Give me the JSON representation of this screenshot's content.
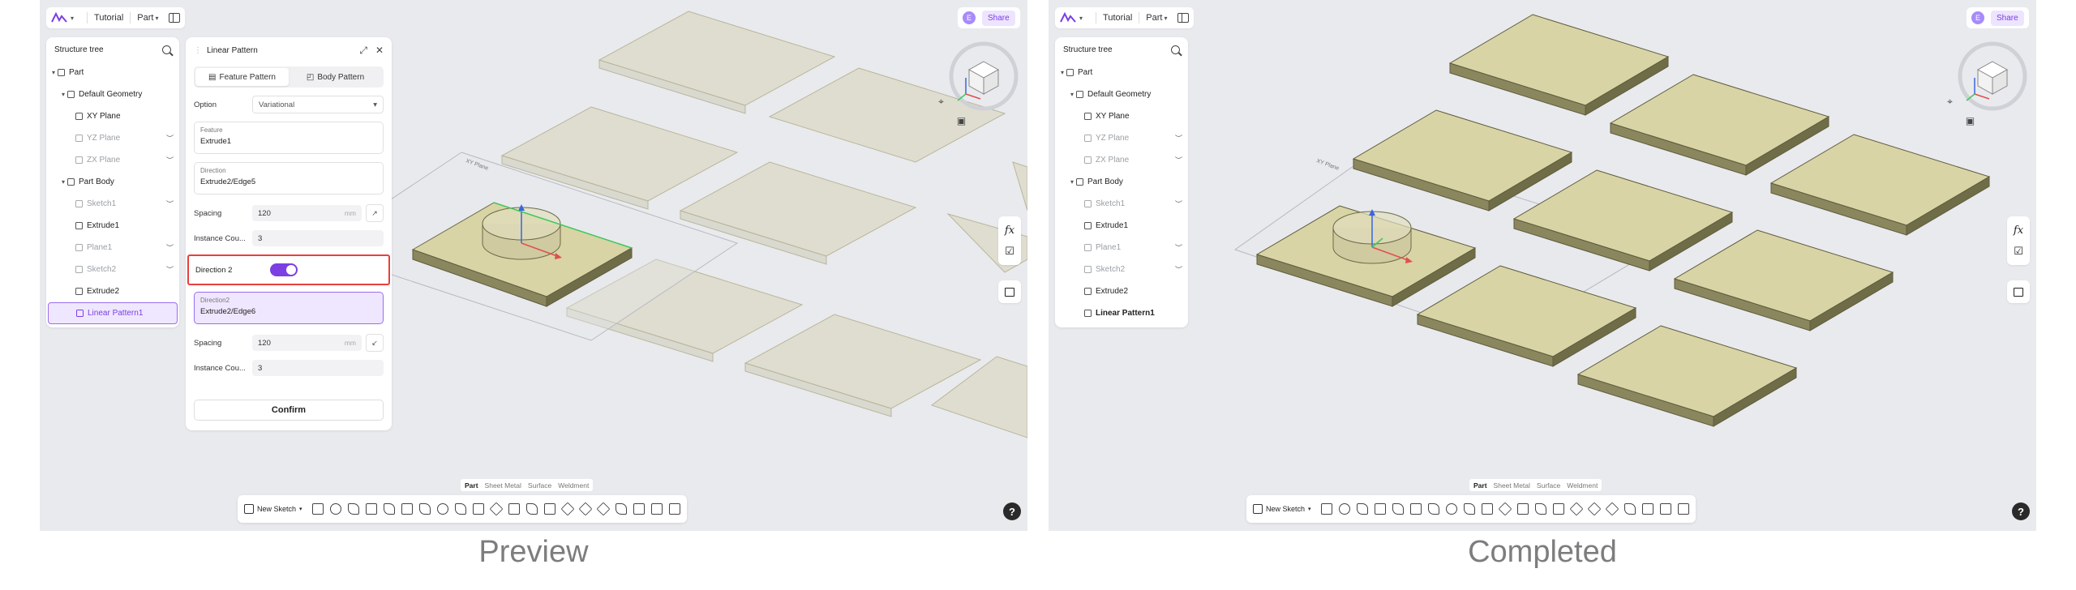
{
  "topbar": {
    "tutorial": "Tutorial",
    "part": "Part"
  },
  "user": {
    "avatar": "E",
    "share": "Share"
  },
  "tree": {
    "title": "Structure tree",
    "items": [
      {
        "label": "Part"
      },
      {
        "label": "Default Geometry"
      },
      {
        "label": "XY Plane"
      },
      {
        "label": "YZ Plane"
      },
      {
        "label": "ZX Plane"
      },
      {
        "label": "Part Body"
      },
      {
        "label": "Sketch1"
      },
      {
        "label": "Extrude1"
      },
      {
        "label": "Plane1"
      },
      {
        "label": "Sketch2"
      },
      {
        "label": "Extrude2"
      },
      {
        "label": "Linear Pattern1"
      }
    ]
  },
  "linear_pattern": {
    "title": "Linear Pattern",
    "tab_feature": "Feature Pattern",
    "tab_body": "Body Pattern",
    "option_label": "Option",
    "option_value": "Variational",
    "feature_label": "Feature",
    "feature_value": "Extrude1",
    "direction_label": "Direction",
    "direction_value": "Extrude2/Edge5",
    "spacing_label": "Spacing",
    "spacing_value": "120",
    "unit": "mm",
    "instance_label": "Instance Cou...",
    "instance_value": "3",
    "direction2_label": "Direction 2",
    "direction2_field_label": "Direction2",
    "direction2_value": "Extrude2/Edge6",
    "spacing2_value": "120",
    "instance2_value": "3",
    "confirm": "Confirm"
  },
  "viewport": {
    "plane_label": "XY Plane"
  },
  "bottom_tabs": [
    "Part",
    "Sheet Metal",
    "Surface",
    "Weldment"
  ],
  "toolbar": {
    "new_sketch": "New Sketch"
  },
  "help": "?",
  "captions": {
    "left": "Preview",
    "right": "Completed"
  },
  "colors": {
    "accent": "#7b3fe4",
    "highlight": "#e8403c",
    "plate_top": "#d8d4a6",
    "plate_side": "#7f7c55"
  }
}
